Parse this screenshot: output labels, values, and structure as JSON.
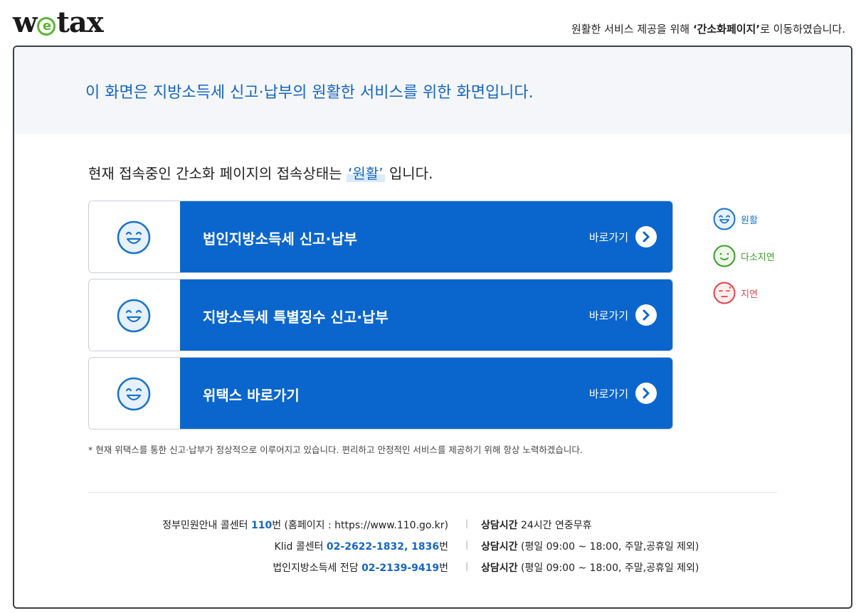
{
  "header": {
    "logo_pre": "w",
    "logo_e": "e",
    "logo_post": "tax",
    "msg_pre": "원활한 서비스 제공을 위해 ",
    "msg_bold": "‘간소화페이지’",
    "msg_post": "로 이동하였습니다."
  },
  "banner": {
    "text": "이 화면은 지방소득세 신고·납부의 원활한 서비스를 위한 화면입니다."
  },
  "status": {
    "pre": "현재 접속중인 간소화 페이지의 접속상태는 ",
    "state": "‘원활’",
    "post": " 입니다."
  },
  "services": [
    {
      "title": "법인지방소득세 신고·납부",
      "go_label": "바로가기",
      "face": "smile-face-icon"
    },
    {
      "title": "지방소득세 특별징수 신고·납부",
      "go_label": "바로가기",
      "face": "smile-face-icon"
    },
    {
      "title": "위택스 바로가기",
      "go_label": "바로가기",
      "face": "smile-face-icon"
    }
  ],
  "legend": [
    {
      "label": "원활",
      "color": "#1a73c9",
      "icon": "smile-face-icon"
    },
    {
      "label": "다소지연",
      "color": "#3c9b2a",
      "icon": "neutral-smile-face-icon"
    },
    {
      "label": "지연",
      "color": "#e0434b",
      "icon": "sweat-face-icon"
    }
  ],
  "note": "* 현재 위택스를 통한 신고·납부가 정상적으로 이루어지고 있습니다. 편리하고 안정적인 서비스를 제공하기 위해 항상 노력하겠습니다.",
  "contacts": [
    {
      "left_pre": "정부민원안내 콜센터 ",
      "left_num": "110",
      "left_post": "번 (홈페이지 : https://www.110.go.kr)",
      "right_bold": "상담시간",
      "right_text": " 24시간 연중무휴"
    },
    {
      "left_pre": "Klid 콜센터 ",
      "left_num": "02-2622-1832, 1836",
      "left_post": "번",
      "right_bold": "상담시간",
      "right_text": " (평일 09:00 ~ 18:00, 주말,공휴일 제외)"
    },
    {
      "left_pre": "법인지방소득세 전담 ",
      "left_num": "02-2139-9419",
      "left_post": "번",
      "right_bold": "상담시간",
      "right_text": " (평일 09:00 ~ 18:00, 주말,공휴일 제외)"
    }
  ],
  "colors": {
    "accent": "#0a66cc",
    "text_blue": "#1665c1",
    "banner_bg": "#f4f6f9"
  }
}
